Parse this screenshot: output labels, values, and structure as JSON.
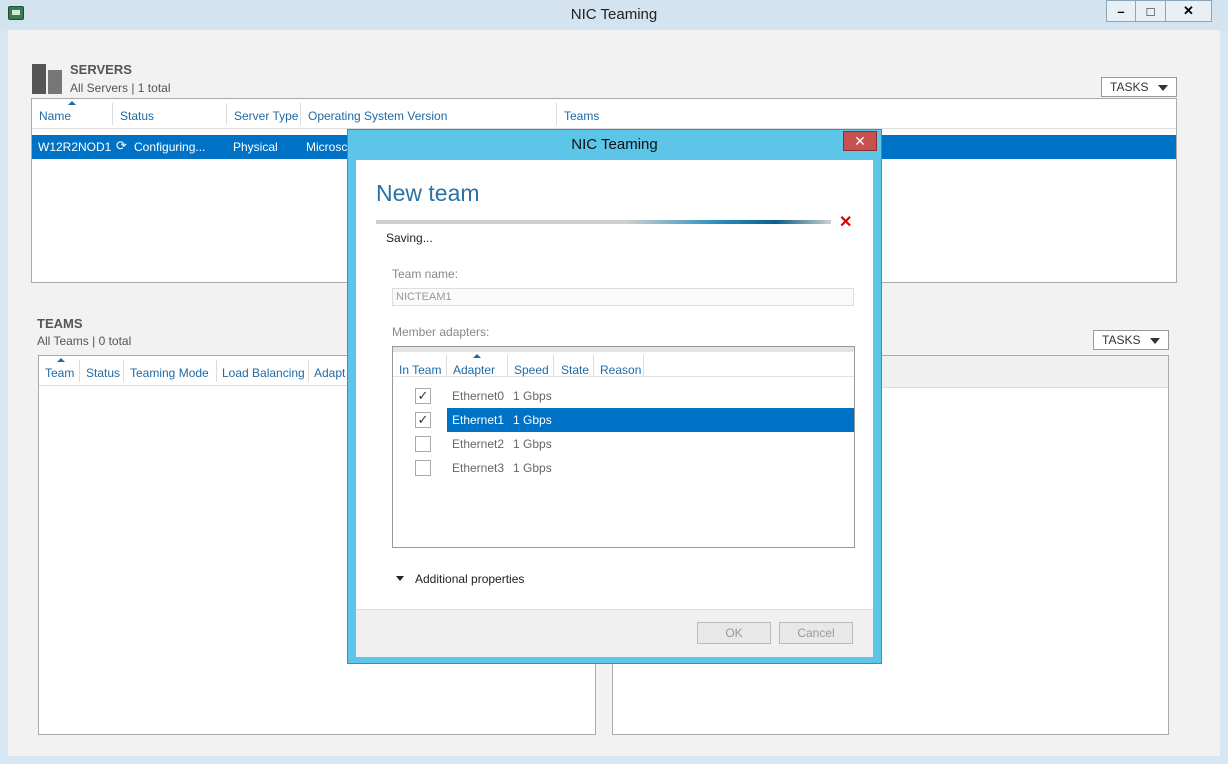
{
  "window": {
    "title": "NIC Teaming"
  },
  "window_buttons": {
    "minimize": "–",
    "maximize": "□",
    "close": "✕"
  },
  "servers": {
    "title": "SERVERS",
    "subtitle": "All Servers | 1 total",
    "tasks_label": "TASKS",
    "columns": [
      "Name",
      "Status",
      "Server Type",
      "Operating System Version",
      "Teams"
    ],
    "row": {
      "name": "W12R2NOD1",
      "status": "Configuring...",
      "server_type": "Physical",
      "os": "Microsc"
    }
  },
  "teams": {
    "title": "TEAMS",
    "subtitle": "All Teams | 0 total",
    "tasks_label": "TASKS",
    "columns": [
      "Team",
      "Status",
      "Teaming Mode",
      "Load Balancing",
      "Adapt"
    ]
  },
  "dialog": {
    "title": "NIC Teaming",
    "close": "✕",
    "heading": "New team",
    "progress_status": "Saving...",
    "cancel_glyph": "✕",
    "team_name_label": "Team name:",
    "team_name_value": "NICTEAM1",
    "member_adapters_label": "Member adapters:",
    "adapter_columns": [
      "In Team",
      "Adapter",
      "Speed",
      "State",
      "Reason"
    ],
    "adapters": [
      {
        "name": "Ethernet0",
        "speed": "1 Gbps",
        "in_team": true,
        "selected": false
      },
      {
        "name": "Ethernet1",
        "speed": "1 Gbps",
        "in_team": true,
        "selected": true
      },
      {
        "name": "Ethernet2",
        "speed": "1 Gbps",
        "in_team": false,
        "selected": false
      },
      {
        "name": "Ethernet3",
        "speed": "1 Gbps",
        "in_team": false,
        "selected": false
      }
    ],
    "additional_properties": "Additional properties",
    "ok_label": "OK",
    "cancel_label": "Cancel"
  },
  "colors": {
    "accent": "#0072c6",
    "dialog_frame": "#5dc5e8",
    "heading": "#2a72a5",
    "close_red": "#c75050"
  }
}
